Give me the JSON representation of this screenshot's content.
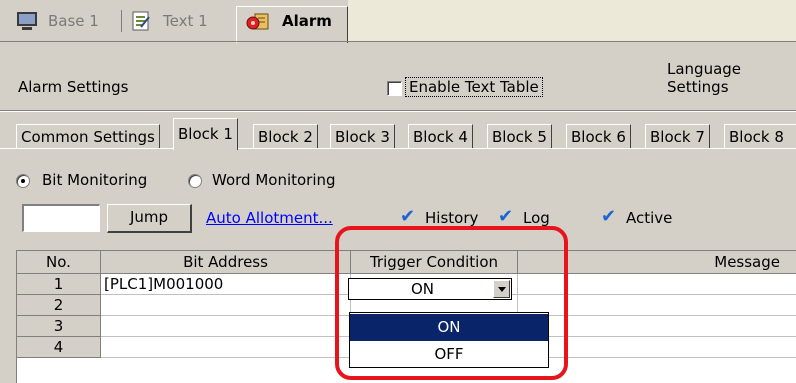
{
  "doc_tabs": [
    {
      "label": "Base 1",
      "icon": "monitor-icon"
    },
    {
      "label": "Text 1",
      "icon": "text-doc-icon"
    },
    {
      "label": "Alarm",
      "icon": "alarm-icon"
    }
  ],
  "header": {
    "title": "Alarm Settings",
    "enable_text_table": "Enable Text Table",
    "language_settings_line1": "Language",
    "language_settings_line2": "Settings"
  },
  "block_tabs": [
    "Common Settings",
    "Block 1",
    "Block 2",
    "Block 3",
    "Block 4",
    "Block 5",
    "Block 6",
    "Block 7",
    "Block 8"
  ],
  "active_block_tab": "Block 1",
  "monitoring": {
    "bit_label": "Bit Monitoring",
    "word_label": "Word Monitoring",
    "selected": "Bit Monitoring"
  },
  "jump": {
    "input_value": "",
    "button_label": "Jump",
    "auto_allotment_link": "Auto Allotment..."
  },
  "options": {
    "history": "History",
    "log": "Log",
    "active": "Active",
    "check_color": "#1e64d0"
  },
  "grid": {
    "headers": [
      "No.",
      "Bit Address",
      "Trigger Condition",
      "Message"
    ],
    "rows": [
      {
        "no": "1",
        "bit_address": "[PLC1]M001000",
        "trigger": "ON"
      },
      {
        "no": "2",
        "bit_address": "",
        "trigger": ""
      },
      {
        "no": "3",
        "bit_address": "",
        "trigger": ""
      },
      {
        "no": "4",
        "bit_address": "",
        "trigger": ""
      }
    ]
  },
  "trigger_dropdown": {
    "current": "ON",
    "options": [
      "ON",
      "OFF"
    ],
    "highlighted": "ON",
    "highlight_color": "#0a246a"
  },
  "annotation_color": "#e8141c"
}
